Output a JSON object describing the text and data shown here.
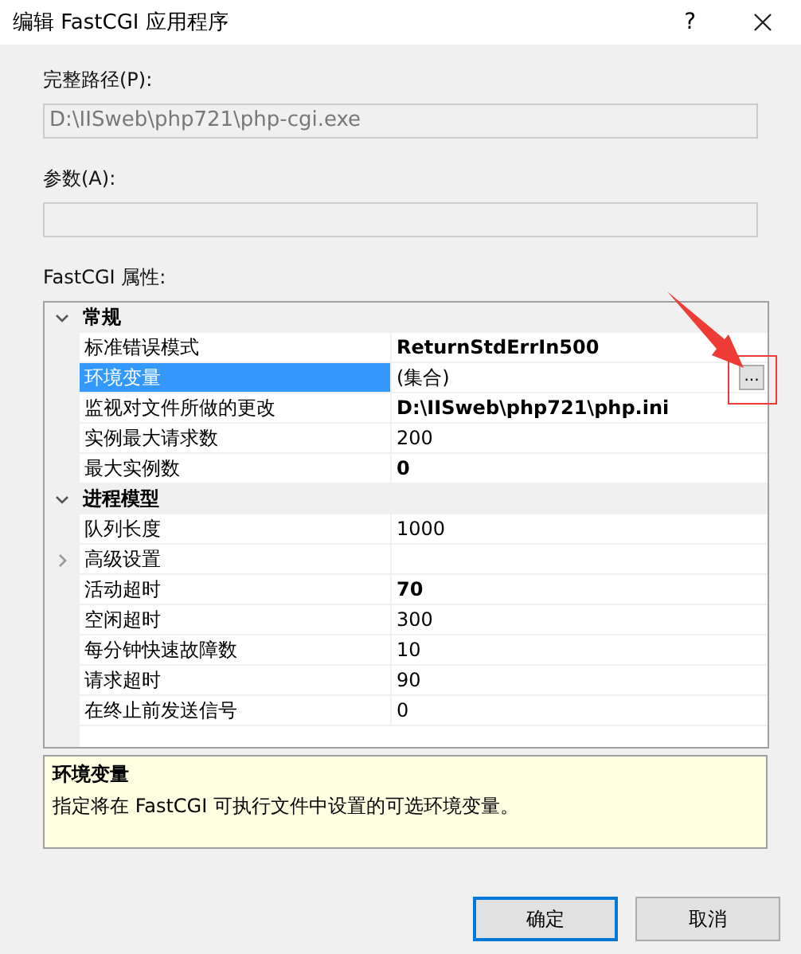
{
  "window": {
    "title": "编辑 FastCGI 应用程序",
    "help": "?"
  },
  "fields": [
    {
      "label": "完整路径(P):",
      "value": "D:\\IISweb\\php721\\php-cgi.exe",
      "disabled": true
    },
    {
      "label": "参数(A):",
      "disabled": true
    }
  ],
  "grid": {
    "label": "FastCGI 属性:",
    "groups": [
      {
        "title": "常规",
        "expanded": true,
        "rows": [
          {
            "kind": "property",
            "name": "标准错误模式",
            "value": "ReturnStdErrIn500",
            "modified": true,
            "selected": false
          },
          {
            "kind": "property",
            "name": "环境变量",
            "value": "(集合)",
            "modified": false,
            "selected": true,
            "button": "..."
          },
          {
            "kind": "property",
            "name": "监视对文件所做的更改",
            "value": "D:\\IISweb\\php721\\php.ini",
            "modified": true,
            "selected": false
          },
          {
            "kind": "property",
            "name": "实例最大请求数",
            "value": "200",
            "modified": false,
            "selected": false
          },
          {
            "kind": "property",
            "name": "最大实例数",
            "value": "0",
            "modified": true,
            "selected": false
          }
        ]
      },
      {
        "title": "进程模型",
        "expanded": true,
        "rows": [
          {
            "kind": "property",
            "name": "队列长度",
            "value": "1000",
            "modified": false,
            "selected": false
          },
          {
            "kind": "group",
            "name": "高级设置",
            "expanded": false,
            "selected": false
          },
          {
            "kind": "property",
            "name": "活动超时",
            "value": "70",
            "modified": true,
            "selected": false
          },
          {
            "kind": "property",
            "name": "空闲超时",
            "value": "300",
            "modified": false,
            "selected": false
          },
          {
            "kind": "property",
            "name": "每分钟快速故障数",
            "value": "10",
            "modified": false,
            "selected": false
          },
          {
            "kind": "property",
            "name": "请求超时",
            "value": "90",
            "modified": false,
            "selected": false
          },
          {
            "kind": "property",
            "name": "在终止前发送信号",
            "value": "0",
            "modified": false,
            "selected": false
          }
        ]
      }
    ]
  },
  "description": {
    "title": "环境变量",
    "text": "指定将在 FastCGI 可执行文件中设置的可选环境变量。"
  },
  "buttons": [
    {
      "label": "确定",
      "default": true
    },
    {
      "label": "取消",
      "default": false
    }
  ],
  "annotations": [
    {
      "kind": "arrow-to-box"
    }
  ]
}
